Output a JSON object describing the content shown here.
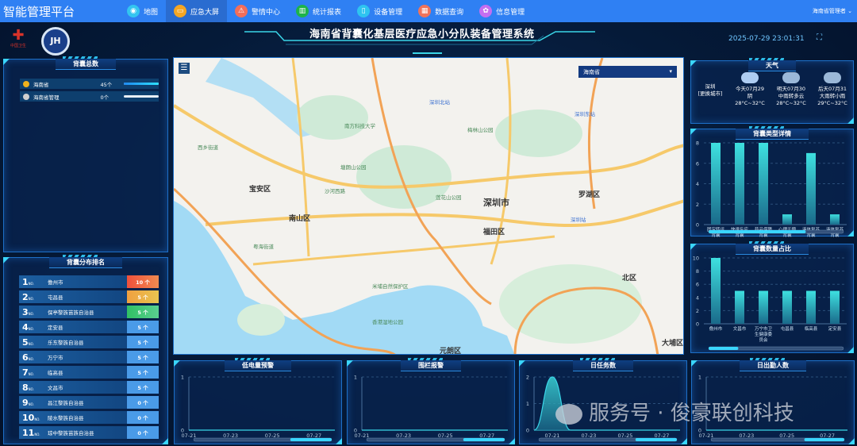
{
  "nav": {
    "brand": "智能管理平台",
    "items": [
      {
        "label": "地图",
        "icon": "map-pin-icon",
        "color": "#33c5f0"
      },
      {
        "label": "应急大屏",
        "icon": "monitor-icon",
        "color": "#f5a623"
      },
      {
        "label": "警情中心",
        "icon": "alarm-icon",
        "color": "#f26e5a"
      },
      {
        "label": "统计报表",
        "icon": "bar-chart-icon",
        "color": "#1db34a"
      },
      {
        "label": "设备管理",
        "icon": "device-icon",
        "color": "#2ec4f0"
      },
      {
        "label": "数据查询",
        "icon": "grid-icon",
        "color": "#f0735a"
      },
      {
        "label": "信息管理",
        "icon": "gear-icon",
        "color": "#c46ef0"
      }
    ],
    "active": 1,
    "user": "海南省管理者"
  },
  "header": {
    "title": "海南省背囊化基层医疗应急小分队装备管理系统",
    "time": "2025-07-29 23:01:31",
    "logo1": "中国卫生",
    "fullscreen": "⛶"
  },
  "total": {
    "title": "背囊总数",
    "rows": [
      {
        "name": "海南省",
        "count": "45个",
        "color": "#f0b21c",
        "fill": 1
      },
      {
        "name": "海南省管理",
        "count": "0个",
        "color": "#cfcfcf",
        "fill": 0
      }
    ]
  },
  "ranking": {
    "title": "背囊分布排名",
    "no": "NO.",
    "rows": [
      {
        "n": "1",
        "name": "儋州市",
        "count": "10 个"
      },
      {
        "n": "2",
        "name": "屯昌县",
        "count": "5 个"
      },
      {
        "n": "3",
        "name": "保亭黎族苗族自治县",
        "count": "5 个"
      },
      {
        "n": "4",
        "name": "定安县",
        "count": "5 个"
      },
      {
        "n": "5",
        "name": "乐东黎族自治县",
        "count": "5 个"
      },
      {
        "n": "6",
        "name": "万宁市",
        "count": "5 个"
      },
      {
        "n": "7",
        "name": "临高县",
        "count": "5 个"
      },
      {
        "n": "8",
        "name": "文昌市",
        "count": "5 个"
      },
      {
        "n": "9",
        "name": "昌江黎族自治县",
        "count": "0 个"
      },
      {
        "n": "10",
        "name": "陵水黎族自治县",
        "count": "0 个"
      },
      {
        "n": "11",
        "name": "琼中黎族苗族自治县",
        "count": "0 个"
      }
    ]
  },
  "map": {
    "select": "海南省",
    "labels": [
      "宝安区",
      "南山区",
      "深圳市",
      "福田区",
      "罗湖区",
      "北区",
      "大埔区",
      "元朗区",
      "西乡街道",
      "深圳北站",
      "深圳东站",
      "深圳站",
      "梅林山公园",
      "莲花山公园",
      "塘朗山公园",
      "香港湿地公园",
      "米埔自然保护区",
      "南方科技大学",
      "沙河西路",
      "粤海街道"
    ]
  },
  "weather": {
    "title": "天气",
    "city": "深圳",
    "city_sub": "[更换城市]",
    "days": [
      {
        "day": "今天07月29",
        "desc": "阴",
        "temp": "28°C~32°C",
        "icon": "cloud-icon"
      },
      {
        "day": "明天07月30",
        "desc": "中雨转多云",
        "temp": "28°C~32°C",
        "icon": "rain-icon"
      },
      {
        "day": "后天07月31",
        "desc": "大雨转小雨",
        "temp": "29°C~32°C",
        "icon": "thunder-rain-icon"
      }
    ]
  },
  "chart_data": [
    {
      "id": "c1",
      "panel_title": "背囊类型详情",
      "type": "bar",
      "categories": [
        "固定转运背囊",
        "快速反应背囊",
        "药品保障背囊",
        "心理干预背囊",
        "液体复苏背囊",
        "液体复苏背囊"
      ],
      "values": [
        8,
        8,
        8,
        1,
        7,
        1
      ],
      "ylim": [
        0,
        8
      ],
      "yticks": [
        0,
        2,
        4,
        6,
        8
      ],
      "scroll": 0.72
    },
    {
      "id": "c2",
      "panel_title": "背囊数量占比",
      "type": "bar",
      "categories": [
        "儋州市",
        "文昌市",
        "万宁市卫生健康委员会",
        "屯昌县",
        "临高县",
        "定安县"
      ],
      "values": [
        10,
        5,
        5,
        5,
        5,
        5
      ],
      "ylim": [
        0,
        10
      ],
      "yticks": [
        0,
        2,
        4,
        6,
        8,
        10
      ],
      "scroll": 0.22
    },
    {
      "id": "c3",
      "panel_title": "低电量预警",
      "type": "line",
      "x": [
        "07-21",
        "07-22",
        "07-23",
        "07-24",
        "07-25",
        "07-26",
        "07-27",
        "07-28"
      ],
      "xticks": [
        "07-21",
        "07-23",
        "07-25",
        "07-27"
      ],
      "values": [
        0,
        0,
        0,
        0,
        0,
        0,
        0,
        0
      ],
      "ylim": [
        0,
        1
      ],
      "yticks": [
        0,
        1
      ],
      "scroll": 0.3
    },
    {
      "id": "c4",
      "panel_title": "围栏报警",
      "type": "line",
      "x": [
        "07-21",
        "07-22",
        "07-23",
        "07-24",
        "07-25",
        "07-26",
        "07-27",
        "07-28"
      ],
      "xticks": [
        "07-21",
        "07-23",
        "07-25",
        "07-27"
      ],
      "values": [
        0,
        0,
        0,
        0,
        0,
        0,
        0,
        0
      ],
      "ylim": [
        0,
        1
      ],
      "yticks": [
        0,
        1
      ],
      "scroll": 0.3
    },
    {
      "id": "c5",
      "panel_title": "日任务数",
      "type": "area",
      "x": [
        "07-20",
        "07-21",
        "07-22",
        "07-23",
        "07-24",
        "07-25",
        "07-26",
        "07-27",
        "07-28"
      ],
      "xticks": [
        "07-21",
        "07-23",
        "07-25",
        "07-27"
      ],
      "values": [
        0,
        2,
        0,
        0,
        0,
        0,
        0,
        0,
        0
      ],
      "ylim": [
        0,
        2
      ],
      "yticks": [
        0,
        1,
        2
      ],
      "scroll": 0.3
    },
    {
      "id": "c6",
      "panel_title": "日出勤人数",
      "type": "line",
      "x": [
        "07-21",
        "07-22",
        "07-23",
        "07-24",
        "07-25",
        "07-26",
        "07-27",
        "07-28"
      ],
      "xticks": [
        "07-21",
        "07-23",
        "07-25",
        "07-27"
      ],
      "values": [
        0,
        0,
        0,
        0,
        0,
        0,
        0,
        0
      ],
      "ylim": [
        0,
        1
      ],
      "yticks": [
        0,
        1
      ],
      "scroll": 0.3
    }
  ],
  "watermark": "服务号 · 俊豪联创科技"
}
